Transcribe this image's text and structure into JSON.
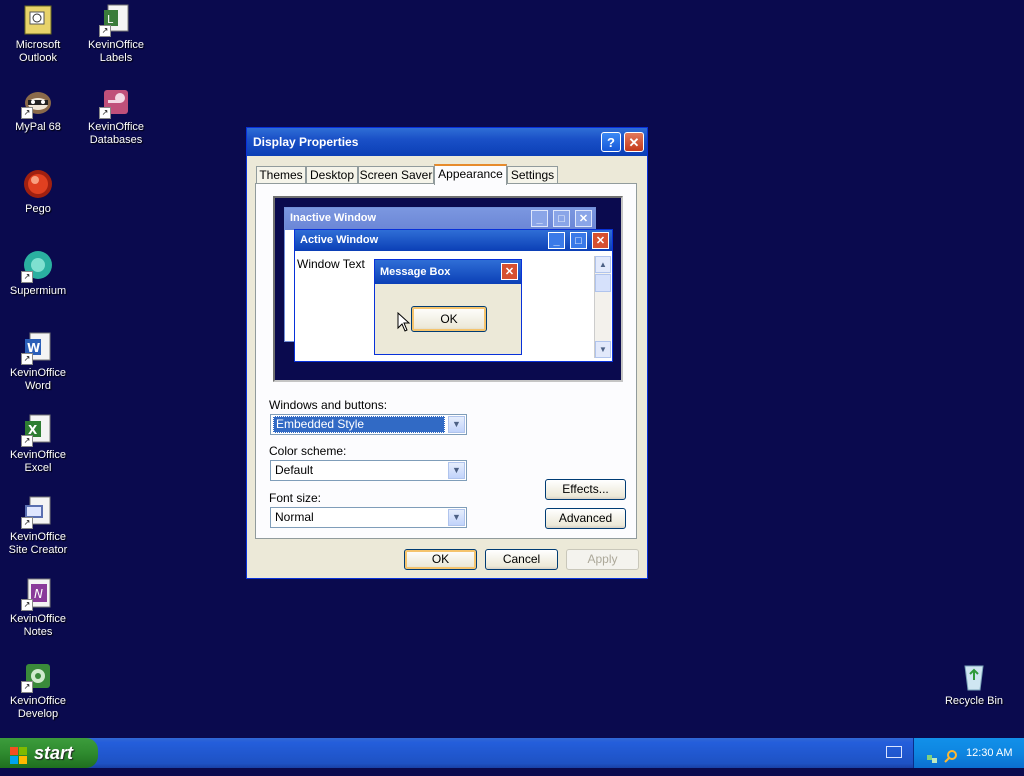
{
  "desktop": {
    "icons": [
      {
        "label": "Microsoft Outlook",
        "line1": "Microsoft",
        "line2": "Outlook"
      },
      {
        "label": "KevinOffice Labels",
        "line1": "KevinOffice",
        "line2": "Labels"
      },
      {
        "label": "MyPal 68",
        "line1": "MyPal 68",
        "line2": ""
      },
      {
        "label": "KevinOffice Databases",
        "line1": "KevinOffice",
        "line2": "Databases"
      },
      {
        "label": "Pego",
        "line1": "Pego",
        "line2": ""
      },
      {
        "label": "Supermium",
        "line1": "Supermium",
        "line2": ""
      },
      {
        "label": "KevinOffice Word",
        "line1": "KevinOffice",
        "line2": "Word"
      },
      {
        "label": "KevinOffice Excel",
        "line1": "KevinOffice",
        "line2": "Excel"
      },
      {
        "label": "KevinOffice Site Creator",
        "line1": "KevinOffice",
        "line2": "Site Creator"
      },
      {
        "label": "KevinOffice Notes",
        "line1": "KevinOffice",
        "line2": "Notes"
      },
      {
        "label": "KevinOffice Develop",
        "line1": "KevinOffice",
        "line2": "Develop"
      },
      {
        "label": "Recycle Bin",
        "line1": "Recycle Bin",
        "line2": ""
      }
    ]
  },
  "dialog": {
    "title": "Display Properties",
    "help_glyph": "?",
    "close_glyph": "✕",
    "tabs": [
      "Themes",
      "Desktop",
      "Screen Saver",
      "Appearance",
      "Settings"
    ],
    "active_tab": "Appearance",
    "preview": {
      "inactive_title": "Inactive Window",
      "active_title": "Active Window",
      "window_text": "Window Text",
      "message_box_title": "Message Box",
      "message_box_ok": "OK"
    },
    "windows_buttons_label": "Windows and buttons:",
    "windows_buttons_value": "Embedded Style",
    "color_scheme_label": "Color scheme:",
    "color_scheme_value": "Default",
    "font_size_label": "Font size:",
    "font_size_value": "Normal",
    "effects_button": "Effects...",
    "advanced_button": "Advanced",
    "ok_button": "OK",
    "cancel_button": "Cancel",
    "apply_button": "Apply"
  },
  "taskbar": {
    "start_label": "start",
    "clock": "12:30 AM"
  },
  "colors": {
    "desktop_bg": "#0a0a4e",
    "titlebar": "#0b3fb6",
    "dialog_bg": "#ece9d8",
    "selection": "#316ac5"
  }
}
